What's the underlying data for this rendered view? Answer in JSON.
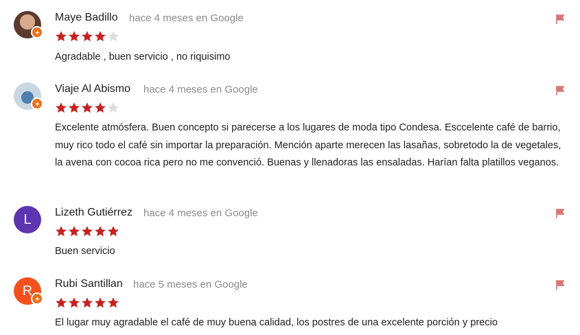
{
  "reviews": [
    {
      "name": "Maye Badillo",
      "time": "hace 4 meses en Google",
      "rating": 4,
      "text": "Agradable , buen servicio , no riquisimo",
      "avatar": {
        "type": "photo",
        "letter": ""
      }
    },
    {
      "name": "Viaje Al Abismo",
      "time": "hace 4 meses en Google",
      "rating": 4,
      "text": "Excelente atmósfera. Buen concepto si parecerse a los lugares de moda tipo Condesa. Esccelente café de barrio, muy rico todo el café sin importar la preparación. Mención aparte merecen las lasañas, sobretodo la de vegetales, la avena con cocoa rica pero no me convenció. Buenas y llenadoras las ensaladas. Harían falta platillos veganos.",
      "avatar": {
        "type": "photo",
        "letter": ""
      }
    },
    {
      "name": "Lizeth Gutiérrez",
      "time": "hace 4 meses en Google",
      "rating": 5,
      "text": "Buen servicio",
      "avatar": {
        "type": "letter",
        "letter": "L",
        "color": "#5e35b1"
      }
    },
    {
      "name": "Rubi Santillan",
      "time": "hace 5 meses en Google",
      "rating": 5,
      "text": "El lugar muy agradable el café de muy buena calidad, los postres de una excelente porción y precio",
      "avatar": {
        "type": "letter",
        "letter": "R",
        "color": "#f4511e"
      }
    }
  ],
  "colors": {
    "star_filled": "#c5221f",
    "star_empty": "#dadce0",
    "flag": "#d97676",
    "badge": "#e8711c"
  },
  "icons": {
    "flag": "flag-icon",
    "star": "star-icon",
    "badge": "local-guide-badge-icon"
  }
}
